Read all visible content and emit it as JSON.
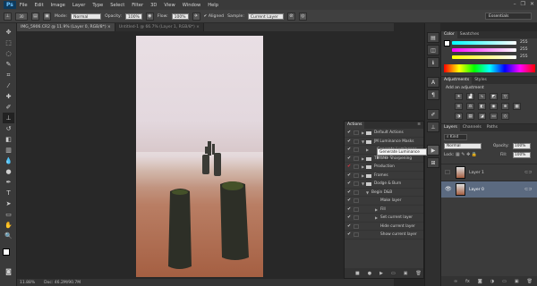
{
  "app": {
    "logo": "Ps"
  },
  "menu": [
    "File",
    "Edit",
    "Image",
    "Layer",
    "Type",
    "Select",
    "Filter",
    "3D",
    "View",
    "Window",
    "Help"
  ],
  "options": {
    "brush_size": "30",
    "mode_label": "Mode:",
    "mode_value": "Normal",
    "opacity_label": "Opacity:",
    "opacity_value": "100%",
    "flow_label": "Flow:",
    "flow_value": "100%",
    "aligned_label": "Aligned",
    "sample_label": "Sample:",
    "sample_value": "Current Layer",
    "workspace": "Essentials"
  },
  "tabs": [
    {
      "label": "IMG_5906.CR2 @ 11.9% (Layer 0, RGB/8*) ×"
    },
    {
      "label": "Untitled-1 @ 66.7% (Layer 1, RGB/8*) ×"
    }
  ],
  "status": {
    "zoom": "11.88%",
    "doc": "Doc: 46.2M/90.7M"
  },
  "color_panel": {
    "tabs": [
      "Color",
      "Swatches"
    ],
    "r": "255",
    "g": "255",
    "b": "255"
  },
  "adjustments_panel": {
    "tabs": [
      "Adjustments",
      "Styles"
    ],
    "hint": "Add an adjustment"
  },
  "layers_panel": {
    "tabs": [
      "Layers",
      "Channels",
      "Paths"
    ],
    "kind": "Kind",
    "blend_mode": "Normal",
    "opacity_label": "Opacity:",
    "opacity": "100%",
    "lock_label": "Lock:",
    "fill_label": "Fill:",
    "fill": "100%",
    "layers": [
      {
        "name": "Layer 1"
      },
      {
        "name": "Layer 0"
      }
    ]
  },
  "actions_panel": {
    "title": "Actions",
    "items": [
      {
        "label": "Default Actions"
      },
      {
        "label": "JM Luminance Masks"
      },
      {
        "label": "Generate Luminance Masks"
      },
      {
        "label": "TK Web Sharpening"
      },
      {
        "label": "Production"
      },
      {
        "label": "Frames"
      },
      {
        "label": "Dodge & Burn"
      },
      {
        "label": "Begin D&B"
      },
      {
        "label": "Make layer"
      },
      {
        "label": "Fill"
      },
      {
        "label": "Set current layer"
      },
      {
        "label": "Hide current layer"
      },
      {
        "label": "Show current layer"
      }
    ],
    "tooltip": "Generate Luminance Masks"
  },
  "colors": {
    "accent": "#2f8de4",
    "selection": "#5b6a80"
  }
}
